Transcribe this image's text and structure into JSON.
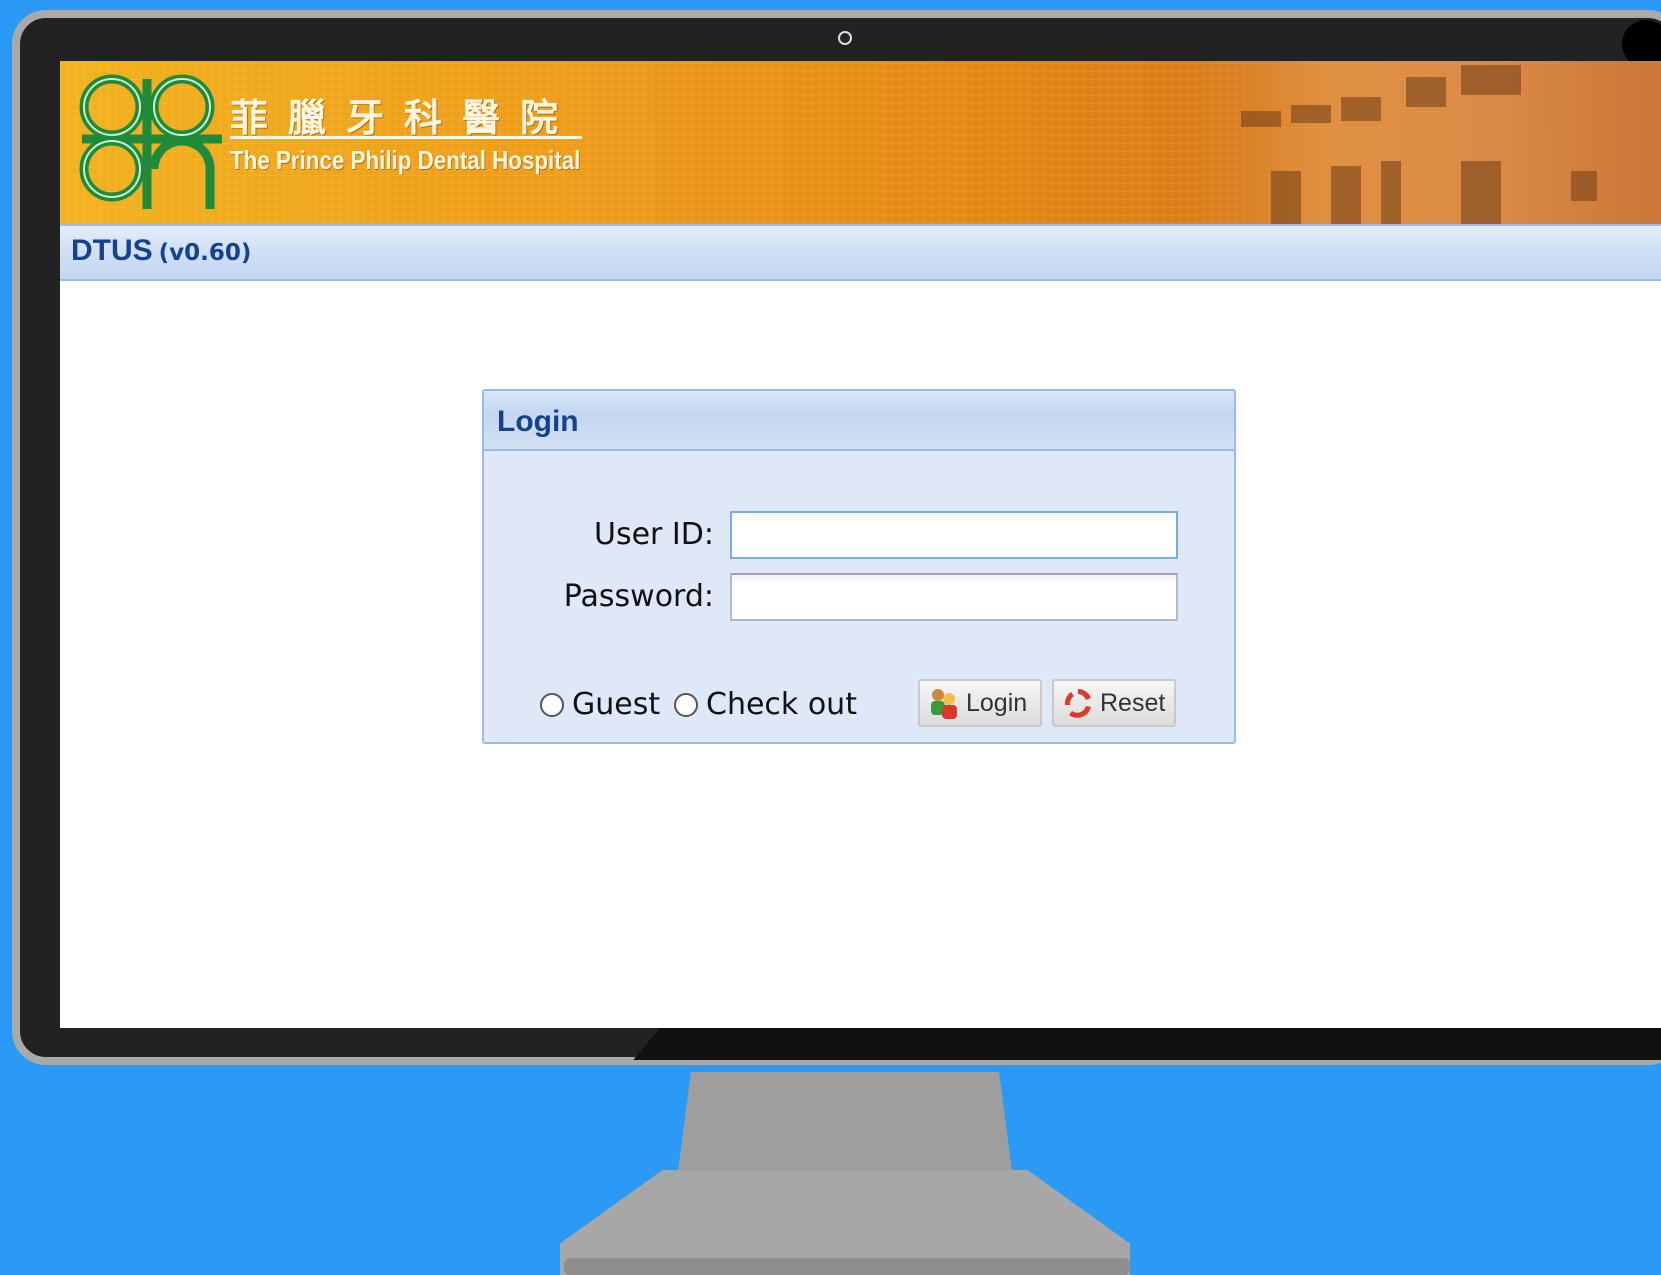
{
  "banner": {
    "hospital_name_cn": "菲臘牙科醫院",
    "hospital_name_en": "The Prince Philip Dental Hospital",
    "logo_icon": "hospital-logo-icon"
  },
  "appbar": {
    "app_name": "DTUS",
    "app_version": "(v0.60)"
  },
  "login_panel": {
    "title": "Login",
    "user_id_label": "User ID:",
    "user_id_value": "",
    "password_label": "Password:",
    "password_value": "",
    "radio_guest": "Guest",
    "radio_checkout": "Check out",
    "login_button": "Login",
    "login_icon": "users-icon",
    "reset_button": "Reset",
    "reset_icon": "refresh-icon"
  },
  "colors": {
    "background": "#2b9af7",
    "header_text": "#15428b",
    "panel_bg": "#dfe8f6",
    "panel_border": "#99bbe8"
  }
}
